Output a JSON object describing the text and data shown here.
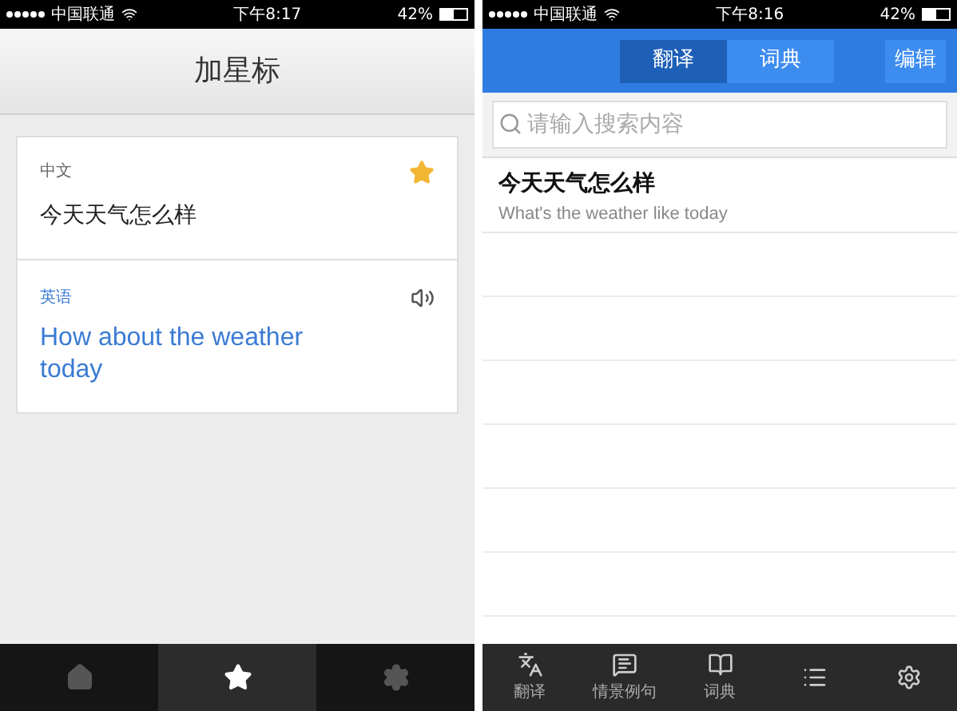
{
  "left_screen": {
    "status_bar": {
      "carrier": "中国联通",
      "time": "下午8:17",
      "battery": "42%"
    },
    "title": "加星标",
    "card": {
      "source": {
        "language": "中文",
        "text": "今天天气怎么样",
        "starred": true
      },
      "target": {
        "language": "英语",
        "text": "How about the weather today"
      }
    },
    "tab_bar": [
      {
        "kind": "home",
        "selected": false
      },
      {
        "kind": "star",
        "selected": true
      },
      {
        "kind": "gear",
        "selected": false
      }
    ]
  },
  "right_screen": {
    "status_bar": {
      "carrier": "中国联通",
      "time": "下午8:16",
      "battery": "42%"
    },
    "segments": [
      {
        "label": "翻译",
        "selected": true
      },
      {
        "label": "词典",
        "selected": false
      }
    ],
    "edit_button": "编辑",
    "search": {
      "placeholder": "请输入搜索内容"
    },
    "history": [
      {
        "text": "今天天气怎么样",
        "translation": "What's the weather like today"
      }
    ],
    "tab_bar": [
      {
        "kind": "translate",
        "label": "翻译",
        "selected": false
      },
      {
        "kind": "chat",
        "label": "情景例句",
        "selected": false
      },
      {
        "kind": "book",
        "label": "词典",
        "selected": false
      },
      {
        "kind": "list",
        "selected": false
      },
      {
        "kind": "gear",
        "selected": false
      }
    ]
  }
}
